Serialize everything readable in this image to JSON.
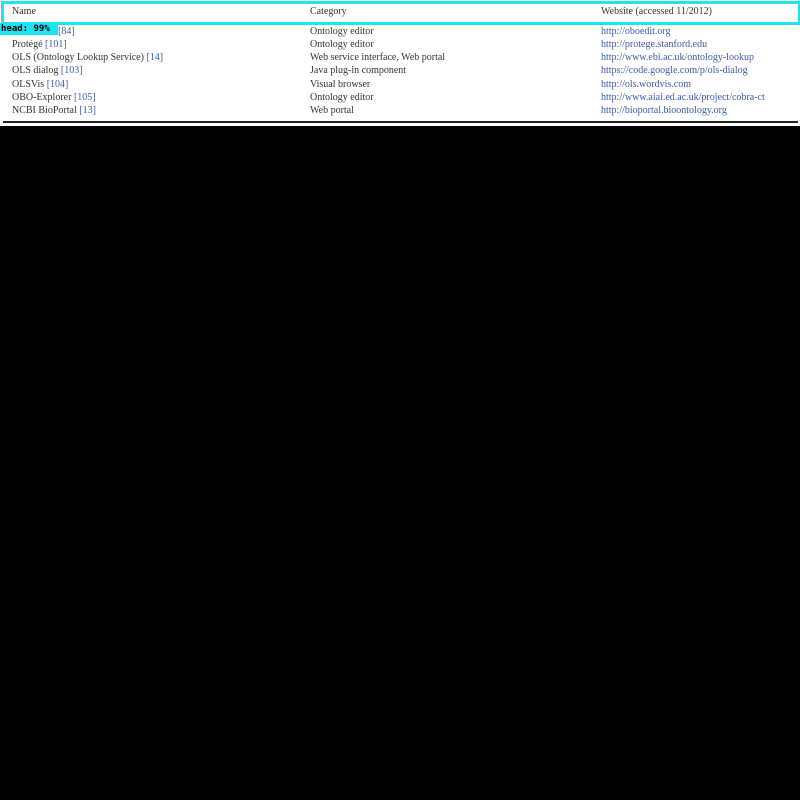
{
  "detection": {
    "label": "head: 99%"
  },
  "table": {
    "headers": {
      "name": "Name",
      "category": "Category",
      "website": "Website (accessed 11/2012)"
    },
    "rows": [
      {
        "name": "",
        "ref": "[84]",
        "category": "Ontology editor",
        "website": "http://oboedit.org"
      },
      {
        "name": "Protégé",
        "ref": "[101]",
        "category": "Ontology editor",
        "website": "http://protege.stanford.edu"
      },
      {
        "name": "OLS (Ontology Lookup Service)",
        "ref": "[14]",
        "category": "Web service interface, Web portal",
        "website": "http://www.ebi.ac.uk/ontology-lookup"
      },
      {
        "name": "OLS dialog",
        "ref": "[103]",
        "category": "Java plug-in component",
        "website": "https://code.google.com/p/ols-dialog"
      },
      {
        "name": "OLSVis",
        "ref": "[104]",
        "category": "Visual browser",
        "website": "http://ols.wordvis.com"
      },
      {
        "name": "OBO-Explorer",
        "ref": "[105]",
        "category": "Ontology editor",
        "website": "http://www.aiai.ed.ac.uk/project/cobra-ct"
      },
      {
        "name": "NCBI BioPortal",
        "ref": "[13]",
        "category": "Web portal",
        "website": "http://bioportal.bioontology.org"
      }
    ]
  },
  "colors": {
    "detection_box": "#1ee3f2",
    "link": "#3b5aa8",
    "background": "#000000"
  }
}
